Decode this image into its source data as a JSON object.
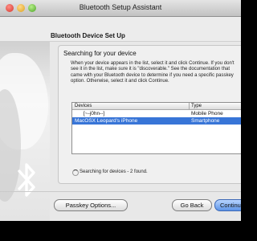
{
  "window": {
    "title": "Bluetooth Setup Assistant"
  },
  "header": {
    "heading": "Bluetooth Device Set Up"
  },
  "panel": {
    "title": "Searching for your device",
    "description": "When your device appears in the list, select it and click Continue. If you don't see it in the list, make sure it is \"discoverable.\" See the documentation that came with your Bluetooth device to determine if you need a specific passkey option. Otherwise, select it and click Continue."
  },
  "device_table": {
    "columns": [
      "Devices",
      "Type"
    ],
    "rows": [
      {
        "device": "[~-j0hn--]",
        "type": "Mobile Phone",
        "selected": false
      },
      {
        "device": "MacOSX Leopard's iPhone",
        "type": "Smartphone",
        "selected": true
      }
    ]
  },
  "status": {
    "text": "Searching for devices - 2 found."
  },
  "buttons": {
    "passkey": "Passkey Options...",
    "back": "Go Back",
    "continue": "Continue"
  },
  "colors": {
    "selection": "#3875d7",
    "default_button": "#5d95e8"
  },
  "icons": {
    "sidebar_logo": "bluetooth-icon",
    "status": "spinner-icon"
  }
}
